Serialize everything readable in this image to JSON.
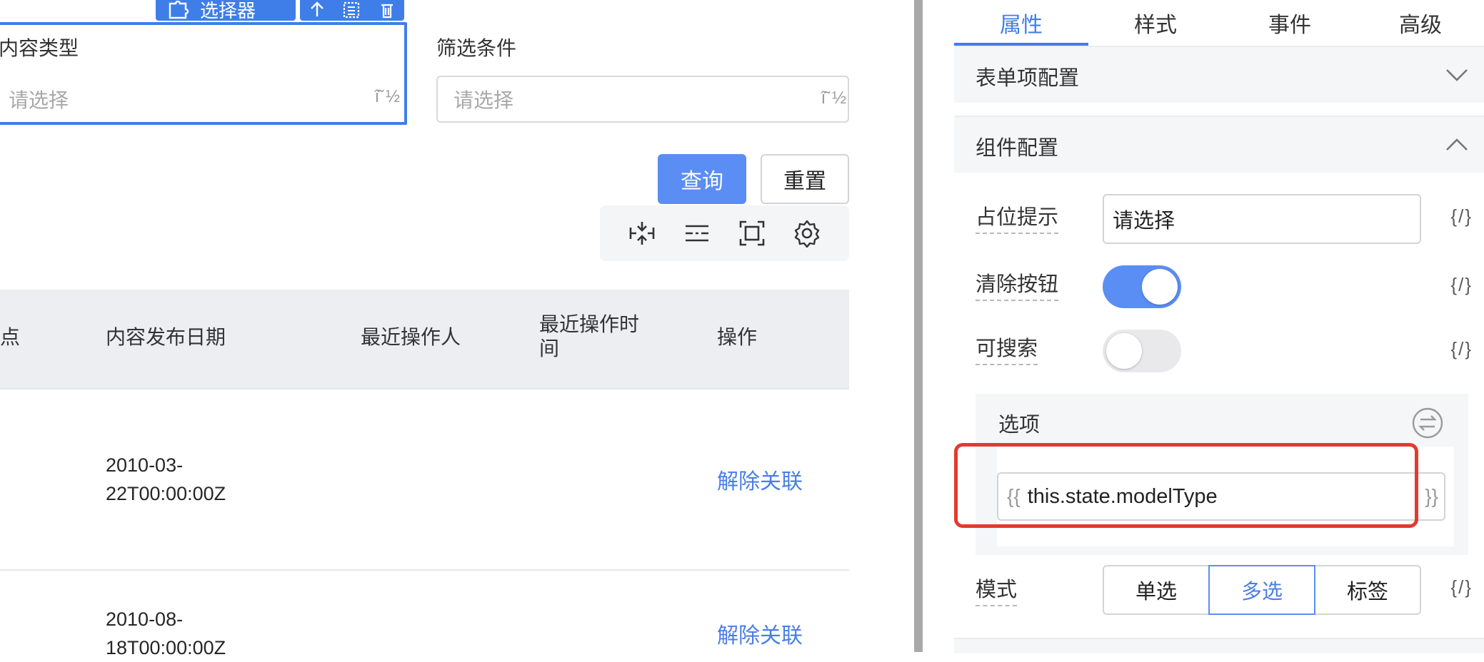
{
  "canvas": {
    "selector_toolbar": {
      "label": "选择器"
    },
    "filters": [
      {
        "label": "内容类型",
        "placeholder": "请选择",
        "arrow": "î˜ ½"
      },
      {
        "label": "筛选条件",
        "placeholder": "请选择",
        "arrow": "î˜ ½"
      }
    ],
    "buttons": {
      "query": "查询",
      "reset": "重置"
    },
    "table": {
      "columns": [
        "点",
        "内容发布日期",
        "最近操作人",
        "最近操作时\n间",
        "操作"
      ],
      "rows": [
        {
          "date": "2010-03-\n22T00:00:00Z",
          "action": "解除关联"
        },
        {
          "date": "2010-08-\n18T00:00:00Z",
          "action": "解除关联"
        }
      ]
    }
  },
  "panel": {
    "tabs": [
      {
        "label": "属性",
        "active": true
      },
      {
        "label": "样式",
        "active": false
      },
      {
        "label": "事件",
        "active": false
      },
      {
        "label": "高级",
        "active": false
      }
    ],
    "sections": {
      "form_item": "表单项配置",
      "component": "组件配置"
    },
    "props": {
      "placeholder_label": "占位提示",
      "placeholder_value": "请选择",
      "clear_label": "清除按钮",
      "clear_on": true,
      "searchable_label": "可搜索",
      "searchable_on": false,
      "options_title": "选项",
      "options_expression": "this.state.modelType",
      "brace_open": "{{",
      "brace_close": "}}",
      "mode_label": "模式",
      "mode_options": [
        "单选",
        "多选",
        "标签"
      ],
      "mode_selected": "多选",
      "expr_toggle": "{/}"
    },
    "colors": {
      "accent": "#3f7ee8",
      "highlight": "#e23b2e"
    }
  }
}
